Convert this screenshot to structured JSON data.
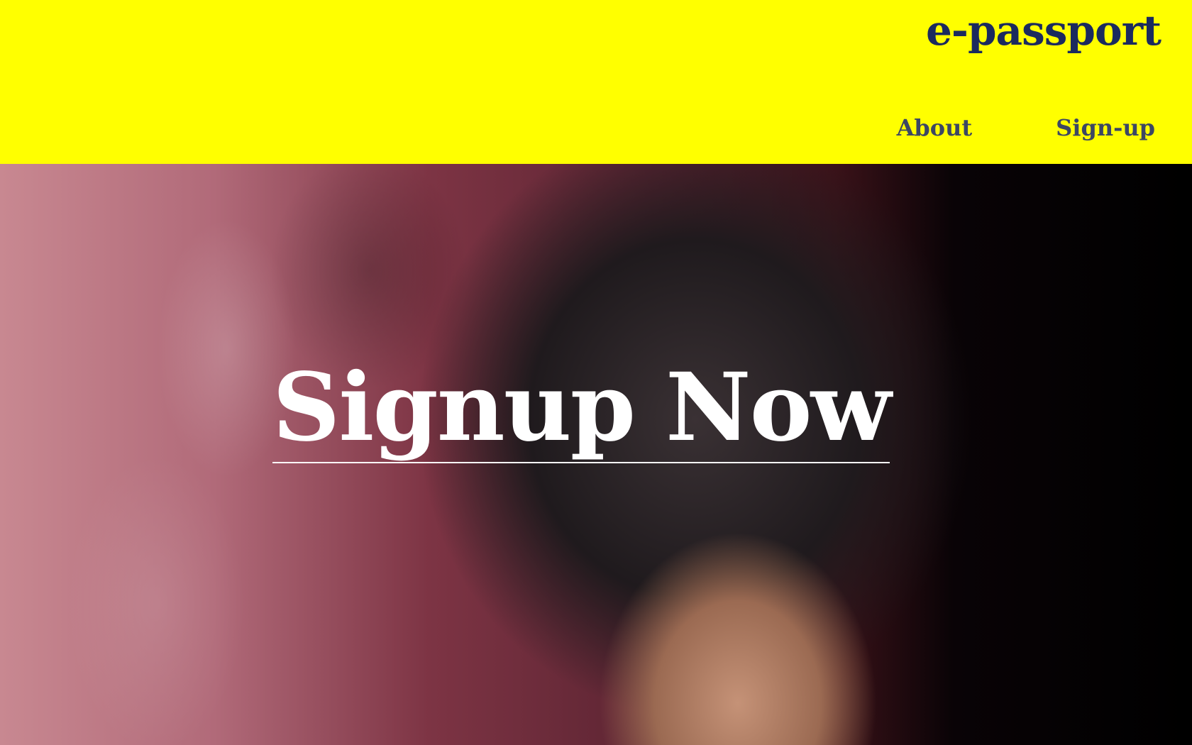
{
  "header": {
    "brand": "e-passport",
    "background_color": "#ffff00",
    "brand_color": "#1b2a5e",
    "nav_color": "#3c4763",
    "nav": [
      {
        "label": "About"
      },
      {
        "label": "Sign-up"
      }
    ]
  },
  "hero": {
    "image": "portrait-photo",
    "cta_label": "Signup Now",
    "cta_color": "#ffffff"
  }
}
